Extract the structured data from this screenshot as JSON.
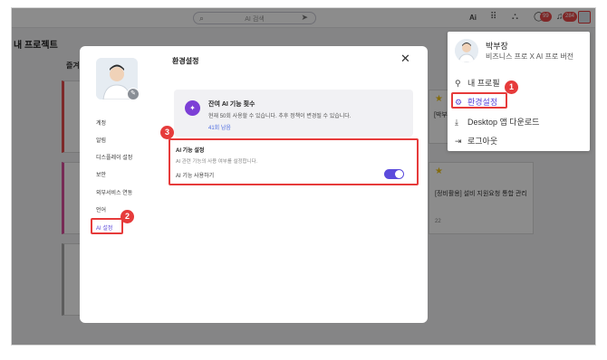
{
  "topbar": {
    "search_placeholder": "AI 검색",
    "ai_label": "Ai",
    "badge_1": "99",
    "badge_2": "284"
  },
  "background": {
    "page_title": "내 프로젝트",
    "tab_label": "즐겨",
    "card_1_title": "[박부",
    "card_2_title": "[정비활용] 설비 지원요청 통합 관리",
    "card_2_count": "22"
  },
  "modal": {
    "title": "환경설정",
    "close_label": "✕",
    "sidebar": {
      "items": [
        {
          "label": "계정"
        },
        {
          "label": "알림"
        },
        {
          "label": "디스플레이 설정"
        },
        {
          "label": "보안"
        },
        {
          "label": "외부서비스 연동"
        },
        {
          "label": "언어"
        },
        {
          "label": "AI 설정"
        }
      ]
    },
    "usage": {
      "title": "잔여 AI 기능 횟수",
      "description": "현재 50회 사용할 수 있습니다. 추후 정책이 변경될 수 있습니다.",
      "remaining": "41회 남음"
    },
    "ai_setting": {
      "title": "AI 기능 설정",
      "hint": "AI 관련 기능의 사용 여부를 설정합니다.",
      "toggle_label": "AI 기능 사용하기",
      "enabled": true
    }
  },
  "dropdown": {
    "user_name": "박부장",
    "plan": "비즈니스 프로 X AI 프로 버전",
    "items": [
      {
        "label": "내 프로필"
      },
      {
        "label": "환경설정"
      },
      {
        "label": "Desktop 앱 다운로드"
      },
      {
        "label": "로그아웃"
      }
    ]
  },
  "markers": {
    "m1": "1",
    "m2": "2",
    "m3": "3"
  },
  "colors": {
    "accent": "#5b4bdc",
    "highlight": "#e63b3b",
    "star": "#f0c419"
  }
}
